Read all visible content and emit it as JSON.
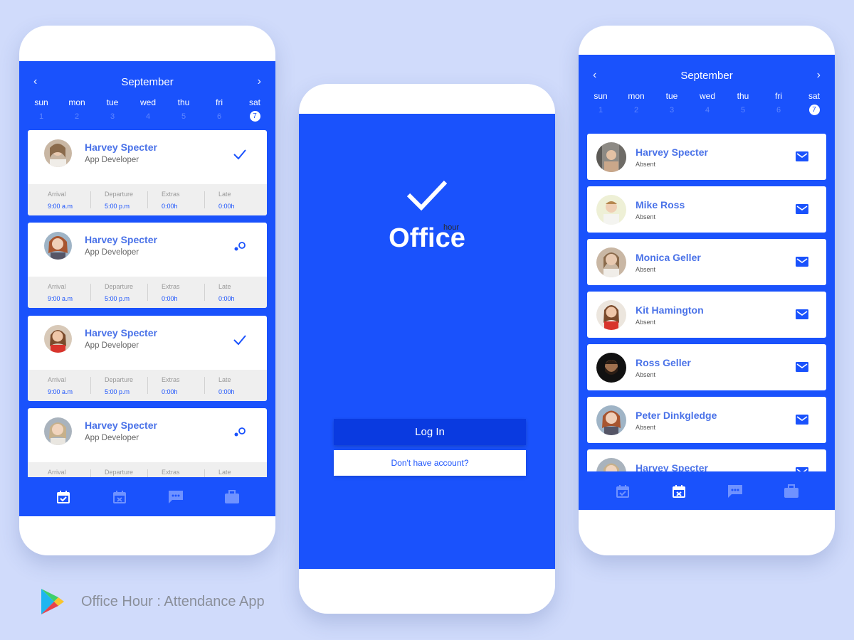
{
  "colors": {
    "primary": "#1a52fc",
    "background": "#d0dbfb",
    "name": "#4a72e8",
    "gray_band": "#efefef"
  },
  "calendar": {
    "month": "September",
    "prev_icon": "chevron-left-icon",
    "next_icon": "chevron-right-icon",
    "days": [
      {
        "name": "sun",
        "date": "1"
      },
      {
        "name": "mon",
        "date": "2"
      },
      {
        "name": "tue",
        "date": "3"
      },
      {
        "name": "wed",
        "date": "4"
      },
      {
        "name": "thu",
        "date": "5"
      },
      {
        "name": "fri",
        "date": "6"
      },
      {
        "name": "sat",
        "date": "7",
        "selected": true
      }
    ]
  },
  "attendance": {
    "labels": {
      "arrival": "Arrival",
      "departure": "Departure",
      "extras": "Extras",
      "late": "Late"
    },
    "cards": [
      {
        "name": "Harvey Specter",
        "role": "App Developer",
        "status": "check-icon",
        "arrival": "9:00 a.m",
        "departure": "5:00 p.m",
        "extras": "0:00h",
        "late": "0:00h"
      },
      {
        "name": "Harvey Specter",
        "role": "App Developer",
        "status": "pending-dots-icon",
        "arrival": "9:00 a.m",
        "departure": "5:00 p.m",
        "extras": "0:00h",
        "late": "0:00h"
      },
      {
        "name": "Harvey Specter",
        "role": "App Developer",
        "status": "check-icon",
        "arrival": "9:00 a.m",
        "departure": "5:00 p.m",
        "extras": "0:00h",
        "late": "0:00h"
      },
      {
        "name": "Harvey Specter",
        "role": "App Developer",
        "status": "pending-dots-icon",
        "arrival": "",
        "departure": "",
        "extras": "",
        "late": ""
      }
    ]
  },
  "tabs": [
    {
      "icon": "calendar-check-icon"
    },
    {
      "icon": "calendar-x-icon"
    },
    {
      "icon": "chat-icon"
    },
    {
      "icon": "briefcase-icon"
    }
  ],
  "login": {
    "brand_word": "Office",
    "brand_small": "hour",
    "login_button": "Log In",
    "signup_link": "Don't have account?"
  },
  "absent_list": [
    {
      "name": "Harvey Specter",
      "status": "Absent"
    },
    {
      "name": "Mike Ross",
      "status": "Absent"
    },
    {
      "name": "Monica Geller",
      "status": "Absent"
    },
    {
      "name": "Kit Hamington",
      "status": "Absent"
    },
    {
      "name": "Ross Geller",
      "status": "Absent"
    },
    {
      "name": "Peter Dinkgledge",
      "status": "Absent"
    },
    {
      "name": "Harvey Specter",
      "status": ""
    }
  ],
  "footer": {
    "title": "Office Hour : Attendance App",
    "logo": "play-store-icon"
  }
}
